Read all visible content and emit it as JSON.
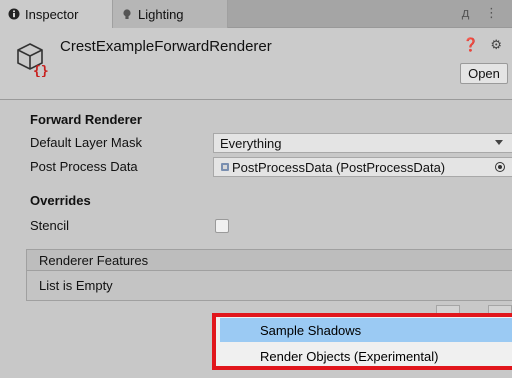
{
  "tabs": [
    {
      "label": "Inspector",
      "icon": "info-icon"
    },
    {
      "label": "Lighting",
      "icon": "bulb-icon"
    }
  ],
  "tabbar_extra": "д ⋮",
  "header": {
    "title": "CrestExampleForwardRenderer",
    "icons": "❓ ⚙",
    "open_label": "Open"
  },
  "forward_renderer": {
    "section_title": "Forward Renderer",
    "default_layer_mask": {
      "label": "Default Layer Mask",
      "value": "Everything"
    },
    "post_process_data": {
      "label": "Post Process Data",
      "value": "PostProcessData (PostProcessData)"
    }
  },
  "overrides": {
    "section_title": "Overrides",
    "stencil": {
      "label": "Stencil",
      "checked": false
    }
  },
  "renderer_features": {
    "header": "Renderer Features",
    "empty_text": "List is Empty"
  },
  "dropdown": {
    "items": [
      "Sample Shadows",
      "Render Objects (Experimental)"
    ],
    "highlighted_index": 0,
    "highlight_color": "#9bcaf3",
    "outline_color": "#e1161c"
  }
}
